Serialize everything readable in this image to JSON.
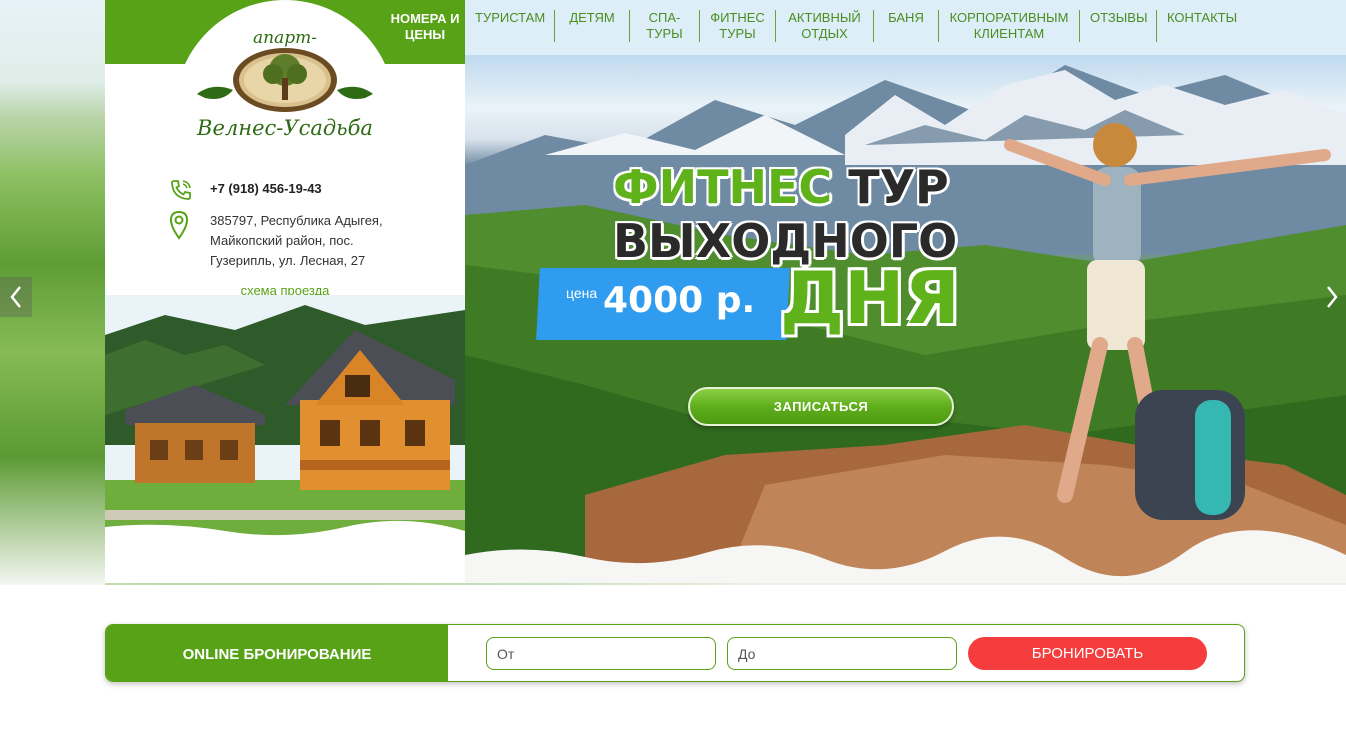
{
  "nav": {
    "active": "НОМЕРА И ЦЕНЫ",
    "items": [
      "ТУРИСТАМ",
      "ДЕТЯМ",
      "СПА-ТУРЫ",
      "ФИТНЕС ТУРЫ",
      "АКТИВНЫЙ ОТДЫХ",
      "БАНЯ",
      "КОРПОРАТИВНЫМ КЛИЕНТАМ",
      "ОТЗЫВЫ",
      "КОНТАКТЫ"
    ]
  },
  "logo": {
    "top_text": "апарт-отель",
    "bottom_text": "Велнес-Усадьба"
  },
  "contacts": {
    "phone": "+7 (918) 456-19-43",
    "address": "385797, Республика Адыгея, Майкопский район, пос. Гузерипль, ул. Лесная, 27",
    "route_link": "схема проезда"
  },
  "hero": {
    "line1_green": "ФИТНЕС",
    "line1_dark": " ТУР",
    "line2": "ВЫХОДНОГО",
    "line3": "ДНЯ",
    "price_label": "цена",
    "price_value": "4000 р.",
    "button": "ЗАПИСАТЬСЯ"
  },
  "booking": {
    "title": "ONLINE БРОНИРОВАНИЕ",
    "from_placeholder": "От",
    "to_placeholder": "До",
    "button": "БРОНИРОВАТЬ"
  },
  "colors": {
    "brand_green": "#57a216",
    "accent_red": "#f53d3d",
    "price_blue": "#2f9cf0"
  }
}
